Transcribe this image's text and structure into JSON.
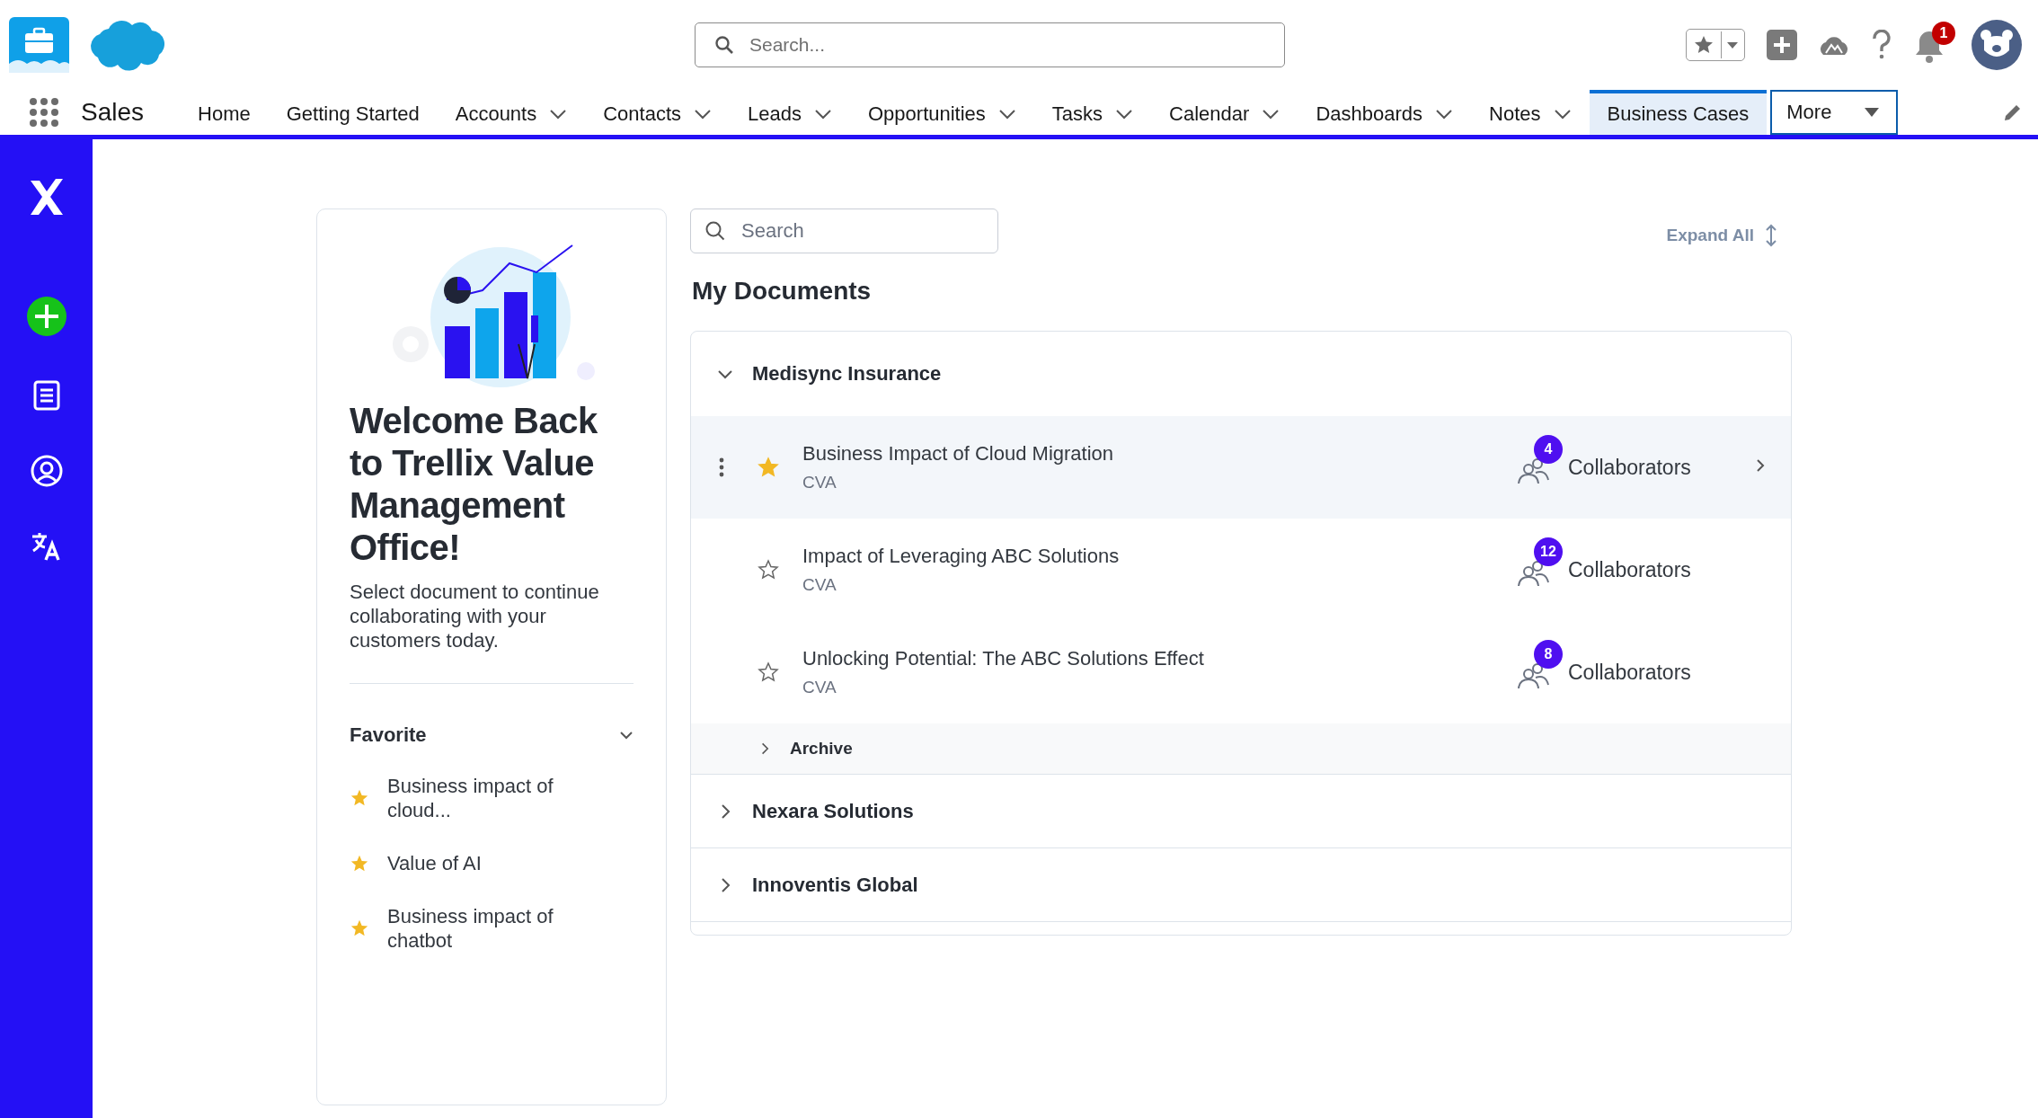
{
  "header": {
    "search_placeholder": "Search...",
    "notification_count": "1"
  },
  "nav": {
    "app_name": "Sales",
    "items": [
      {
        "label": "Home",
        "dropdown": false,
        "selected": false
      },
      {
        "label": "Getting Started",
        "dropdown": false,
        "selected": false
      },
      {
        "label": "Accounts",
        "dropdown": true,
        "selected": false
      },
      {
        "label": "Contacts",
        "dropdown": true,
        "selected": false
      },
      {
        "label": "Leads",
        "dropdown": true,
        "selected": false
      },
      {
        "label": "Opportunities",
        "dropdown": true,
        "selected": false
      },
      {
        "label": "Tasks",
        "dropdown": true,
        "selected": false
      },
      {
        "label": "Calendar",
        "dropdown": true,
        "selected": false
      },
      {
        "label": "Dashboards",
        "dropdown": true,
        "selected": false
      },
      {
        "label": "Notes",
        "dropdown": true,
        "selected": false
      },
      {
        "label": "Business Cases",
        "dropdown": false,
        "selected": true
      }
    ],
    "more": "More"
  },
  "welcome": {
    "title": "Welcome Back to Trellix Value Management Office!",
    "subtitle": "Select document to continue collaborating with your customers today.",
    "favorites": {
      "title": "Favorite",
      "expanded": true,
      "items": [
        {
          "label": "Business impact of cloud..."
        },
        {
          "label": "Value of AI"
        },
        {
          "label": "Business impact of chatbot"
        }
      ]
    }
  },
  "documents": {
    "search_placeholder": "Search",
    "expand_all": "Expand All",
    "heading": "My Documents",
    "groups": [
      {
        "name": "Medisync Insurance",
        "expanded": true,
        "documents": [
          {
            "title": "Business Impact of Cloud Migration",
            "type": "CVA",
            "favorite": true,
            "collaborator_count": "4",
            "collaborators_label": "Collaborators",
            "selected": true
          },
          {
            "title": "Impact of Leveraging ABC Solutions",
            "type": "CVA",
            "favorite": false,
            "collaborator_count": "12",
            "collaborators_label": "Collaborators",
            "selected": false
          },
          {
            "title": "Unlocking Potential: The ABC Solutions Effect",
            "type": "CVA",
            "favorite": false,
            "collaborator_count": "8",
            "collaborators_label": "Collaborators",
            "selected": false
          }
        ],
        "archive": {
          "label": "Archive",
          "expanded": false
        }
      },
      {
        "name": "Nexara Solutions",
        "expanded": false
      },
      {
        "name": "Innoventis Global",
        "expanded": false
      }
    ]
  }
}
